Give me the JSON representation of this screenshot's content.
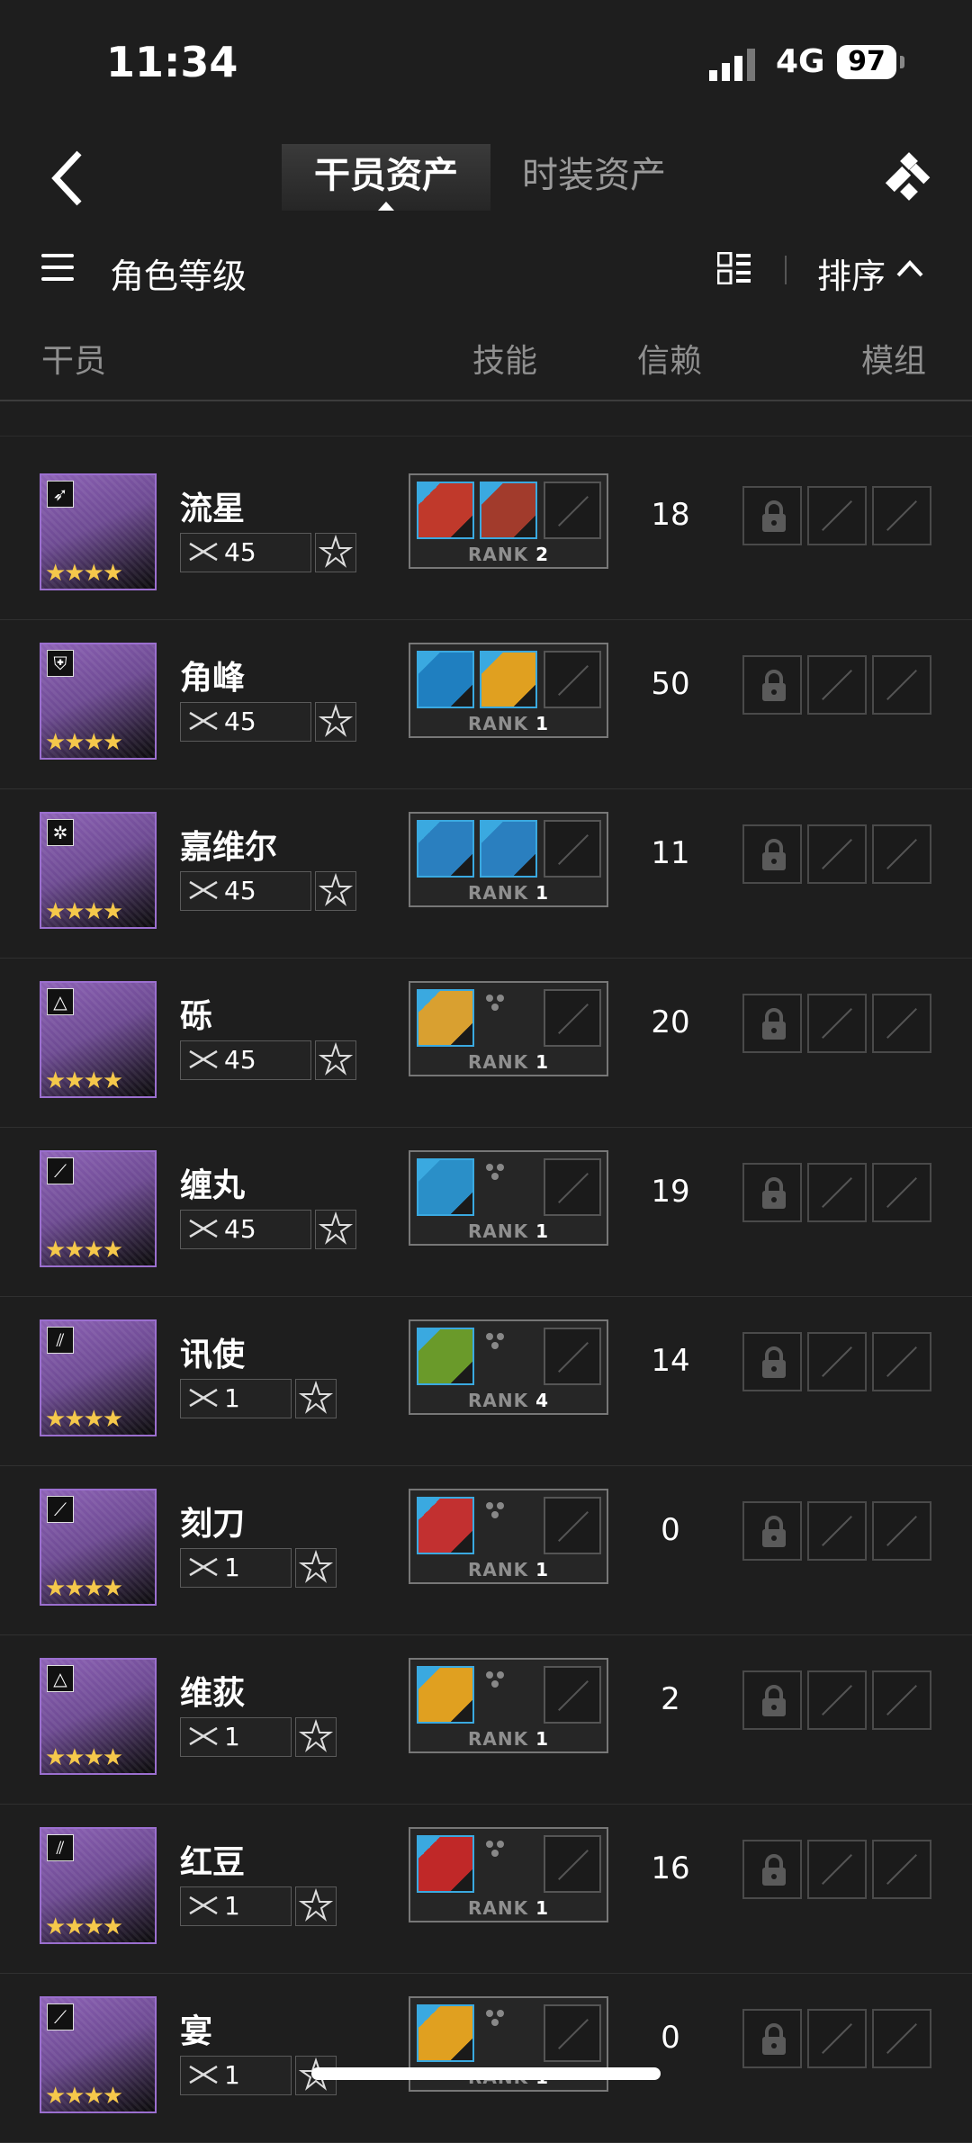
{
  "status_bar": {
    "time": "11:34",
    "network": "4G",
    "battery": "97"
  },
  "nav": {
    "tab_active": "干员资产",
    "tab_inactive": "时装资产"
  },
  "filter": {
    "label": "角色等级",
    "sort_label": "排序"
  },
  "columns": {
    "operator": "干员",
    "skill": "技能",
    "trust": "信赖",
    "module": "模组"
  },
  "operators": [
    {
      "name": "流星",
      "class_icon": "sniper-icon",
      "level": "45",
      "trust": "18",
      "rank_label": "RANK",
      "rank": "2",
      "skills": 2,
      "stars": "★★★★"
    },
    {
      "name": "角峰",
      "class_icon": "defender-icon",
      "level": "45",
      "trust": "50",
      "rank_label": "RANK",
      "rank": "1",
      "skills": 2,
      "stars": "★★★★"
    },
    {
      "name": "嘉维尔",
      "class_icon": "medic-icon",
      "level": "45",
      "trust": "11",
      "rank_label": "RANK",
      "rank": "1",
      "skills": 2,
      "stars": "★★★★"
    },
    {
      "name": "砾",
      "class_icon": "specialist-icon",
      "level": "45",
      "trust": "20",
      "rank_label": "RANK",
      "rank": "1",
      "skills": 1,
      "stars": "★★★★"
    },
    {
      "name": "缠丸",
      "class_icon": "guard-icon",
      "level": "45",
      "trust": "19",
      "rank_label": "RANK",
      "rank": "1",
      "skills": 1,
      "stars": "★★★★"
    },
    {
      "name": "讯使",
      "class_icon": "vanguard-icon",
      "level": "1",
      "trust": "14",
      "rank_label": "RANK",
      "rank": "4",
      "skills": 1,
      "stars": "★★★★"
    },
    {
      "name": "刻刀",
      "class_icon": "guard-icon",
      "level": "1",
      "trust": "0",
      "rank_label": "RANK",
      "rank": "1",
      "skills": 1,
      "stars": "★★★★"
    },
    {
      "name": "维荻",
      "class_icon": "specialist-icon",
      "level": "1",
      "trust": "2",
      "rank_label": "RANK",
      "rank": "1",
      "skills": 1,
      "stars": "★★★★"
    },
    {
      "name": "红豆",
      "class_icon": "vanguard-icon",
      "level": "1",
      "trust": "16",
      "rank_label": "RANK",
      "rank": "1",
      "skills": 1,
      "stars": "★★★★"
    },
    {
      "name": "宴",
      "class_icon": "guard-icon",
      "level": "1",
      "trust": "0",
      "rank_label": "RANK",
      "rank": "1",
      "skills": 1,
      "stars": "★★★★"
    }
  ],
  "colors": {
    "portrait_border": "#9b6fcf",
    "star": "#f5c84b",
    "skill_border": "#3aa9e0",
    "background": "#1e1e1e"
  }
}
